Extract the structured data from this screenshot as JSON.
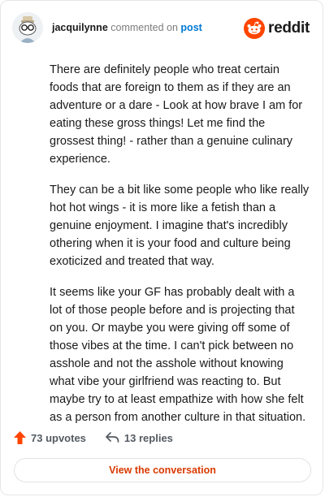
{
  "header": {
    "username": "jacquilynne",
    "action_text": " commented on ",
    "post_link": "post",
    "brand": "reddit"
  },
  "comment": {
    "paragraphs": [
      "There are definitely people who treat certain foods that are foreign to them as if they are an adventure or a dare - Look at how brave I am for eating these gross things! Let me find the grossest thing! - rather than a genuine culinary experience.",
      "They can be a bit like some people who like really hot hot wings - it is more like a fetish than a genuine enjoyment. I imagine that's incredibly othering when it is your food and culture being exoticized and treated that way.",
      "It seems like your GF has probably dealt with a lot of those people before and is projecting that on you. Or maybe you were giving off some of those vibes at the time. I can't pick between no asshole and not the asshole without knowing what vibe your girlfriend was reacting to. But maybe try to at least empathize with how she felt as a person from another culture in that situation."
    ]
  },
  "footer": {
    "upvotes": "73 upvotes",
    "replies": "13 replies",
    "view_conversation": "View the conversation"
  },
  "colors": {
    "accent": "#ff4500",
    "link": "#0079d3",
    "cta": "#d93a00"
  },
  "icons": {
    "avatar": "snoo-avatar-icon",
    "brand": "reddit-logo-icon",
    "upvote": "upvote-arrow-icon",
    "reply": "reply-arrow-icon"
  }
}
